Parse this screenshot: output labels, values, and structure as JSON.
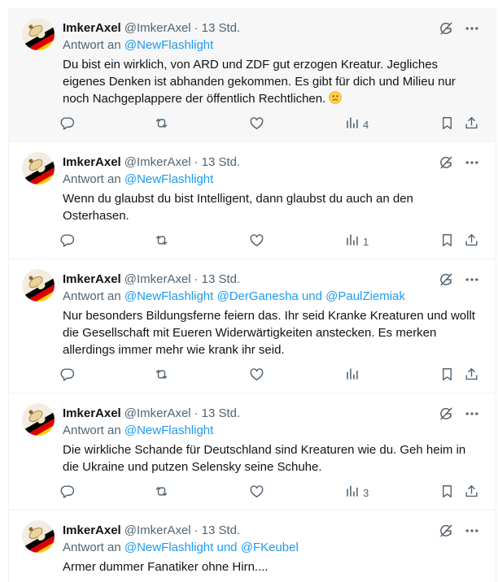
{
  "icons": {
    "grok": "grok-icon",
    "more": "more-icon",
    "reply": "reply-icon",
    "repost": "repost-icon",
    "like": "like-icon",
    "views": "views-icon",
    "bookmark": "bookmark-icon",
    "share": "share-icon"
  },
  "colors": {
    "link": "#1d9bf0",
    "muted": "#536471",
    "text": "#0f1419",
    "highlight_bg": "#f7f7f7"
  },
  "tweets": [
    {
      "name": "ImkerAxel",
      "handle": "@ImkerAxel",
      "dot": "·",
      "time": "13 Std.",
      "reply_prefix": "Antwort an ",
      "reply_m1": "@NewFlashlight",
      "reply_sep1": "",
      "reply_m2": "",
      "reply_sep2": "",
      "reply_m3": "",
      "text": "Du bist ein wirklich, von ARD und ZDF gut erzogen Kreatur. Jegliches eigenes Denken ist abhanden gekommen. Es gibt für dich und Milieu nur noch Nachgeplappere der öffentlich Rechtlichen.",
      "emoji": "worried-face-emoji",
      "views": "4"
    },
    {
      "name": "ImkerAxel",
      "handle": "@ImkerAxel",
      "dot": "·",
      "time": "13 Std.",
      "reply_prefix": "Antwort an ",
      "reply_m1": "@NewFlashlight",
      "reply_sep1": "",
      "reply_m2": "",
      "reply_sep2": "",
      "reply_m3": "",
      "text": "Wenn du glaubst du bist Intelligent, dann glaubst du auch an den Osterhasen.",
      "views": "1"
    },
    {
      "name": "ImkerAxel",
      "handle": "@ImkerAxel",
      "dot": "·",
      "time": "13 Std.",
      "reply_prefix": "Antwort an ",
      "reply_m1": "@NewFlashlight",
      "reply_sep1": " ",
      "reply_m2": "@DerGanesha",
      "reply_sep2": " und ",
      "reply_m3": "@PaulZiemiak",
      "text": "Nur besonders Bildungsferne feiern das. Ihr seid Kranke Kreaturen und wollt die Gesellschaft mit Eueren Widerwärtigkeiten anstecken. Es merken allerdings immer mehr wie krank ihr seid.",
      "views": ""
    },
    {
      "name": "ImkerAxel",
      "handle": "@ImkerAxel",
      "dot": "·",
      "time": "13 Std.",
      "reply_prefix": "Antwort an ",
      "reply_m1": "@NewFlashlight",
      "reply_sep1": "",
      "reply_m2": "",
      "reply_sep2": "",
      "reply_m3": "",
      "text": "Die wirkliche Schande für Deutschland sind Kreaturen wie du. Geh heim in die Ukraine und putzen Selensky seine Schuhe.",
      "views": "3"
    },
    {
      "name": "ImkerAxel",
      "handle": "@ImkerAxel",
      "dot": "·",
      "time": "13 Std.",
      "reply_prefix": "Antwort an ",
      "reply_m1": "@NewFlashlight",
      "reply_sep1": " und ",
      "reply_m2": "@FKeubel",
      "reply_sep2": "",
      "reply_m3": "",
      "text": "Armer dummer Fanatiker ohne Hirn....",
      "views": ""
    }
  ]
}
